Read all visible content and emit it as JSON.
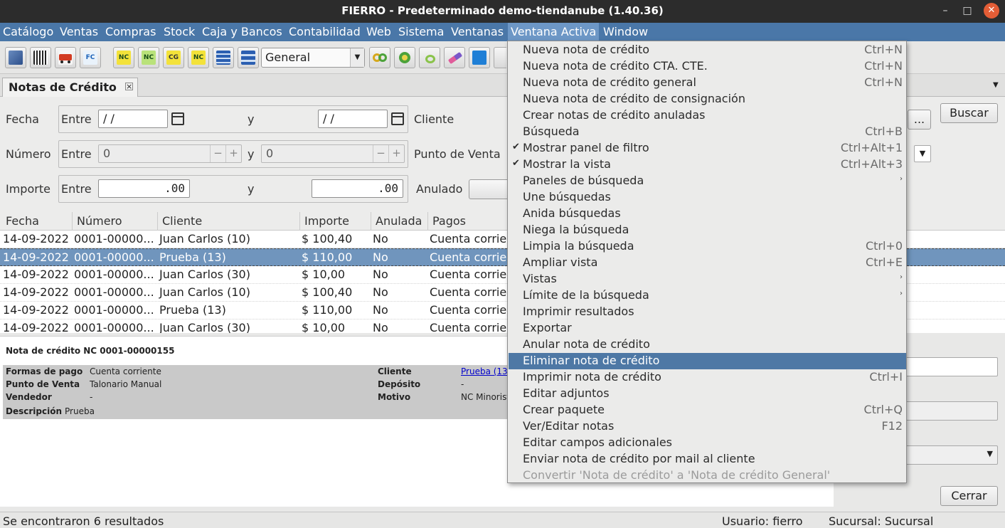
{
  "window": {
    "title": "FIERRO - Predeterminado demo-tiendanube (1.40.36)",
    "minimize": "–",
    "maximize": "□",
    "close": "✕"
  },
  "menubar": [
    "Catálogo",
    "Ventas",
    "Compras",
    "Stock",
    "Caja y Bancos",
    "Contabilidad",
    "Web",
    "Sistema",
    "Ventanas",
    "Ventana Activa",
    "Window"
  ],
  "toolbar": {
    "buttons": [
      {
        "icon": "book-icon",
        "label": ""
      },
      {
        "icon": "barcode-icon",
        "label": ""
      },
      {
        "icon": "truck-icon",
        "label": ""
      },
      {
        "icon": "invoice-fc-icon",
        "label": "FC"
      },
      {
        "icon": "credit-note-nc-icon",
        "label": "NC"
      },
      {
        "icon": "credit-note-nc-green-icon",
        "label": "NC"
      },
      {
        "icon": "cg-icon",
        "label": "CG"
      },
      {
        "icon": "nc-yellow-icon",
        "label": "NC"
      },
      {
        "icon": "panel-icon",
        "label": ""
      },
      {
        "icon": "panel-split-icon",
        "label": ""
      }
    ],
    "view_combo": "General",
    "buttons2": [
      "rings-icon",
      "green-circle-icon",
      "ring-icon",
      "eraser-icon",
      "photo-icon"
    ]
  },
  "tab": {
    "label": "Notas de Crédito",
    "close": "×"
  },
  "filter": {
    "fecha_label": "Fecha",
    "entre": "Entre",
    "y": "y",
    "fecha_from": " / /",
    "fecha_to": " / /",
    "cliente_label": "Cliente",
    "numero_label": "Número",
    "numero_from": "0",
    "numero_to": "0",
    "punto_venta_label": "Punto de Venta",
    "importe_label": "Importe",
    "importe_from": ".00",
    "importe_to": ".00",
    "anulado_label": "Anulado",
    "cliente_btn": "...",
    "buscar": "Buscar"
  },
  "table": {
    "columns": [
      "Fecha",
      "Número",
      "Cliente",
      "Importe",
      "Anulada",
      "Pagos"
    ],
    "rows": [
      [
        "14-09-2022",
        "0001-00000...",
        "Juan Carlos (10)",
        "$ 100,40",
        "No",
        "Cuenta corrie"
      ],
      [
        "14-09-2022",
        "0001-00000...",
        "Prueba (13)",
        "$ 110,00",
        "No",
        "Cuenta corrie"
      ],
      [
        "14-09-2022",
        "0001-00000...",
        "Juan Carlos (30)",
        "$ 10,00",
        "No",
        "Cuenta corrie"
      ],
      [
        "14-09-2022",
        "0001-00000...",
        "Juan Carlos (10)",
        "$ 100,40",
        "No",
        "Cuenta corrie"
      ],
      [
        "14-09-2022",
        "0001-00000...",
        "Prueba (13)",
        "$ 110,00",
        "No",
        "Cuenta corrie"
      ],
      [
        "14-09-2022",
        "0001-00000...",
        "Juan Carlos (30)",
        "$ 10,00",
        "No",
        "Cuenta corrie"
      ]
    ],
    "selected_index": 1
  },
  "detail": {
    "title": "Nota de crédito NC 0001-00000155",
    "formas_pago_k": "Formas de pago",
    "formas_pago_v": "Cuenta corriente",
    "punto_venta_k": "Punto de Venta",
    "punto_venta_v": "Talonario Manual",
    "vendedor_k": "Vendedor",
    "vendedor_v": "-",
    "descripcion_k": "Descripción",
    "descripcion_v": "Prueba",
    "cliente_k": "Cliente",
    "cliente_v": "Prueba (13",
    "deposito_k": "Depósito",
    "deposito_v": "-",
    "motivo_k": "Motivo",
    "motivo_v": "NC Minorist"
  },
  "right": {
    "cerrar": "Cerrar"
  },
  "status": {
    "results": "Se encontraron 6 resultados",
    "user": "Usuario: fierro",
    "branch": "Sucursal: Sucursal"
  },
  "menu": {
    "items": [
      {
        "label": "Nueva nota de crédito",
        "shortcut": "Ctrl+N"
      },
      {
        "label": "Nueva nota de crédito CTA. CTE.",
        "shortcut": "Ctrl+N"
      },
      {
        "label": "Nueva nota de crédito general",
        "shortcut": "Ctrl+N"
      },
      {
        "label": "Nueva nota de crédito de consignación",
        "shortcut": ""
      },
      {
        "label": "Crear notas de crédito anuladas",
        "shortcut": ""
      },
      {
        "label": "Búsqueda",
        "shortcut": "Ctrl+B"
      },
      {
        "label": "Mostrar panel de filtro",
        "shortcut": "Ctrl+Alt+1",
        "checked": true
      },
      {
        "label": "Mostrar la vista",
        "shortcut": "Ctrl+Alt+3",
        "checked": true
      },
      {
        "label": "Paneles de búsqueda",
        "shortcut": "",
        "submenu": true
      },
      {
        "label": "Une búsquedas",
        "shortcut": ""
      },
      {
        "label": "Anida búsquedas",
        "shortcut": ""
      },
      {
        "label": "Niega la búsqueda",
        "shortcut": ""
      },
      {
        "label": "Limpia la búsqueda",
        "shortcut": "Ctrl+0"
      },
      {
        "label": "Ampliar vista",
        "shortcut": "Ctrl+E"
      },
      {
        "label": "Vistas",
        "shortcut": "",
        "submenu": true
      },
      {
        "label": "Límite de la búsqueda",
        "shortcut": "",
        "submenu": true
      },
      {
        "label": "Imprimir resultados",
        "shortcut": ""
      },
      {
        "label": "Exportar",
        "shortcut": ""
      },
      {
        "label": "Anular nota de crédito",
        "shortcut": ""
      },
      {
        "label": "Eliminar nota de crédito",
        "shortcut": "",
        "highlight": true
      },
      {
        "label": "Imprimir nota de crédito",
        "shortcut": "Ctrl+I"
      },
      {
        "label": "Editar adjuntos",
        "shortcut": ""
      },
      {
        "label": "Crear paquete",
        "shortcut": "Ctrl+Q"
      },
      {
        "label": "Ver/Editar notas",
        "shortcut": "F12"
      },
      {
        "label": "Editar campos adicionales",
        "shortcut": ""
      },
      {
        "label": "Enviar nota de crédito por mail al cliente",
        "shortcut": ""
      },
      {
        "label": "Convertir 'Nota de crédito' a 'Nota de crédito General'",
        "shortcut": "",
        "disabled": true
      }
    ]
  },
  "colors": {
    "menubar": "#4a77a8",
    "highlight": "#4e78a5",
    "selected_row": "#7095bd"
  }
}
